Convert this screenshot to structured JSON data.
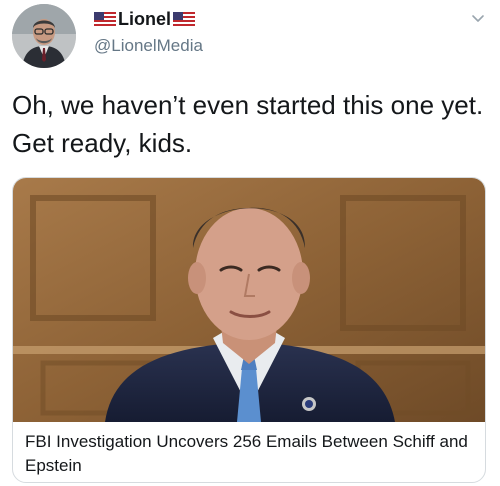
{
  "tweet": {
    "display_name": "Lionel",
    "handle": "@LionelMedia",
    "text": "Oh, we haven’t even started this one yet. Get ready, kids.",
    "avatar_icon": "user-avatar-photo",
    "flag_icon": "us-flag-icon",
    "menu_icon": "chevron-down-icon"
  },
  "card": {
    "title": "FBI Investigation Uncovers 256 Emails Between Schiff and Epstein",
    "image_icon": "news-photo"
  },
  "colors": {
    "text": "#14171a",
    "secondary": "#657786",
    "border": "#d6dbdf"
  }
}
